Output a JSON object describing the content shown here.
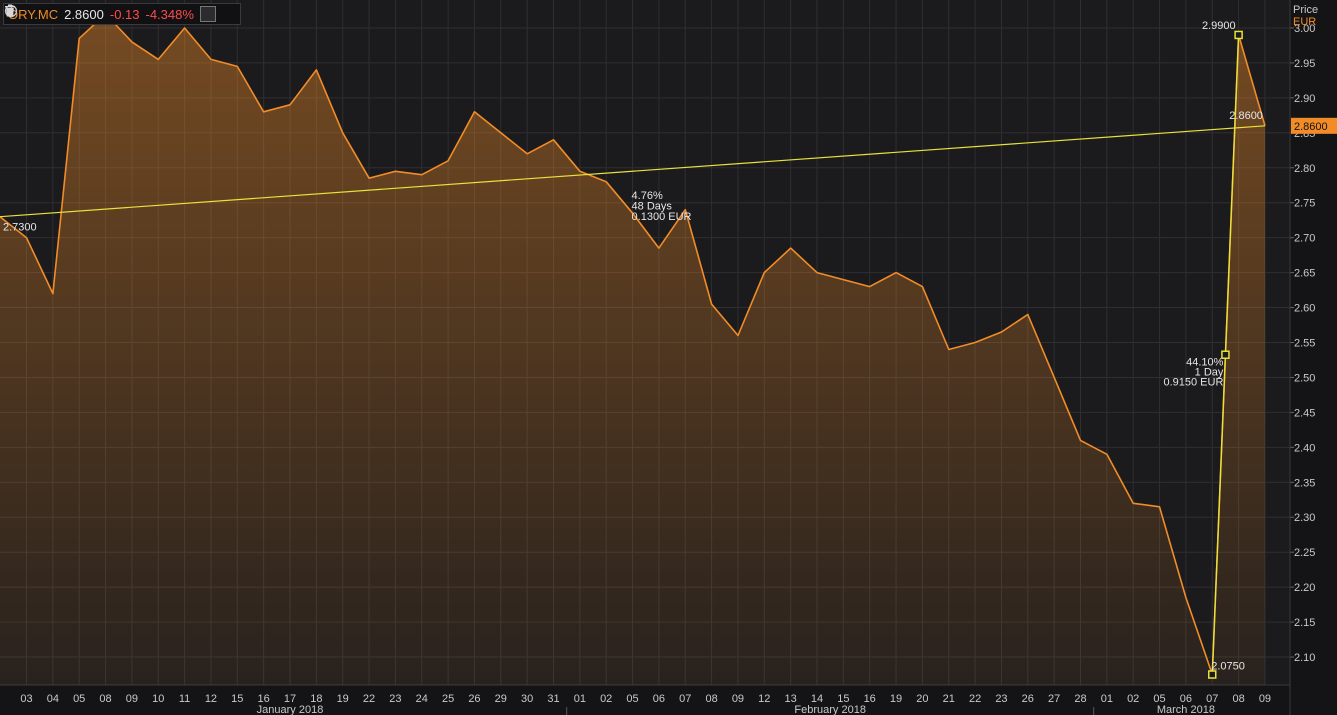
{
  "toolbar": {
    "symbol": "ORY.MC",
    "price": "2.8600",
    "change": "-0.13",
    "change_pct": "-4.348%",
    "icons": [
      "clock-icon",
      "chevron-down-icon",
      "trash-icon"
    ]
  },
  "axis_header": {
    "label": "Price",
    "currency": "EUR"
  },
  "colors": {
    "background": "#1b1b1d",
    "line": "#f28c28",
    "fill": "#f28c28",
    "trendline": "#e8e23a",
    "grid": "#2f2f31",
    "text": "#c9c9c9",
    "last_price_tag": "#f28c28"
  },
  "chart_data": {
    "type": "area",
    "x": [
      "03",
      "04",
      "05",
      "08",
      "09",
      "10",
      "11",
      "12",
      "15",
      "16",
      "17",
      "18",
      "19",
      "22",
      "23",
      "24",
      "25",
      "26",
      "29",
      "30",
      "31",
      "01",
      "02",
      "05",
      "06",
      "07",
      "08",
      "09",
      "12",
      "13",
      "14",
      "15",
      "16",
      "19",
      "20",
      "21",
      "22",
      "23",
      "26",
      "27",
      "28",
      "01",
      "02",
      "05",
      "06",
      "07",
      "08",
      "09"
    ],
    "values": [
      2.7,
      2.62,
      2.985,
      3.02,
      2.98,
      2.955,
      3.0,
      2.955,
      2.945,
      2.88,
      2.89,
      2.94,
      2.85,
      2.785,
      2.795,
      2.79,
      2.81,
      2.88,
      2.85,
      2.82,
      2.84,
      2.795,
      2.78,
      2.735,
      2.685,
      2.74,
      2.605,
      2.56,
      2.65,
      2.685,
      2.65,
      2.64,
      2.63,
      2.65,
      2.63,
      2.54,
      2.55,
      2.565,
      2.59,
      2.5,
      2.41,
      2.39,
      2.32,
      2.315,
      2.185,
      2.075,
      2.99,
      2.86
    ],
    "start_value": 2.73,
    "months": [
      {
        "label": "January 2018",
        "from": 0,
        "to": 20
      },
      {
        "label": "February 2018",
        "from": 21,
        "to": 40
      },
      {
        "label": "March 2018",
        "from": 41,
        "to": 47
      }
    ],
    "y_ticks": [
      2.1,
      2.15,
      2.2,
      2.25,
      2.3,
      2.35,
      2.4,
      2.45,
      2.5,
      2.55,
      2.6,
      2.65,
      2.7,
      2.75,
      2.8,
      2.85,
      2.9,
      2.95,
      3.0
    ],
    "ylim": [
      2.06,
      3.04
    ],
    "last_price": "2.8600",
    "y_axis_side": "right",
    "grid": true,
    "annotations": {
      "trend": {
        "from_value": 2.73,
        "to_value": 2.86,
        "start_label": "2.7300",
        "end_label": "2.8600",
        "lines": [
          "4.76%",
          "48 Days",
          "0.1300 EUR"
        ]
      },
      "jump": {
        "low_value": 2.075,
        "high_value": 2.99,
        "low_label": "2.0750",
        "high_label": "2.9900",
        "lines": [
          "44.10%",
          "1 Day",
          "0.9150 EUR"
        ]
      }
    }
  }
}
